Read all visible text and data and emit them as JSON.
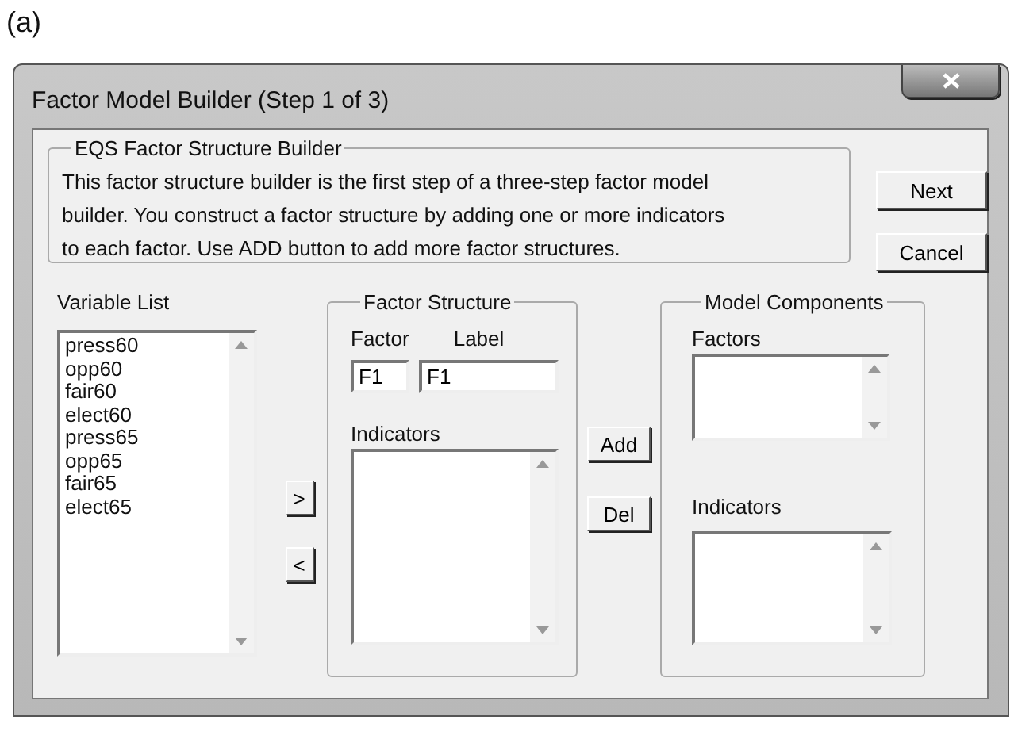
{
  "figure_label": "(a)",
  "window": {
    "title": "Factor Model Builder (Step 1 of 3)"
  },
  "intro": {
    "title": "EQS Factor Structure Builder",
    "lines": [
      "This factor structure builder is the first step of a three-step factor model",
      "builder.  You construct a factor structure by adding one or more indicators",
      "to each factor.  Use ADD button to add more factor structures."
    ]
  },
  "buttons": [
    "Next",
    "Cancel"
  ],
  "variable_list": {
    "label": "Variable List",
    "items": [
      "press60",
      "opp60",
      "fair60",
      "elect60",
      "press65",
      "opp65",
      "fair65",
      "elect65"
    ]
  },
  "move_buttons": [
    ">",
    "<"
  ],
  "factor_structure": {
    "title": "Factor Structure",
    "factor_label": "Factor",
    "label_label": "Label",
    "factor_value": "F1",
    "label_value": "F1",
    "indicators_label": "Indicators"
  },
  "edit_buttons": [
    "Add",
    "Del"
  ],
  "model_components": {
    "title": "Model Components",
    "factors_label": "Factors",
    "indicators_label": "Indicators"
  }
}
